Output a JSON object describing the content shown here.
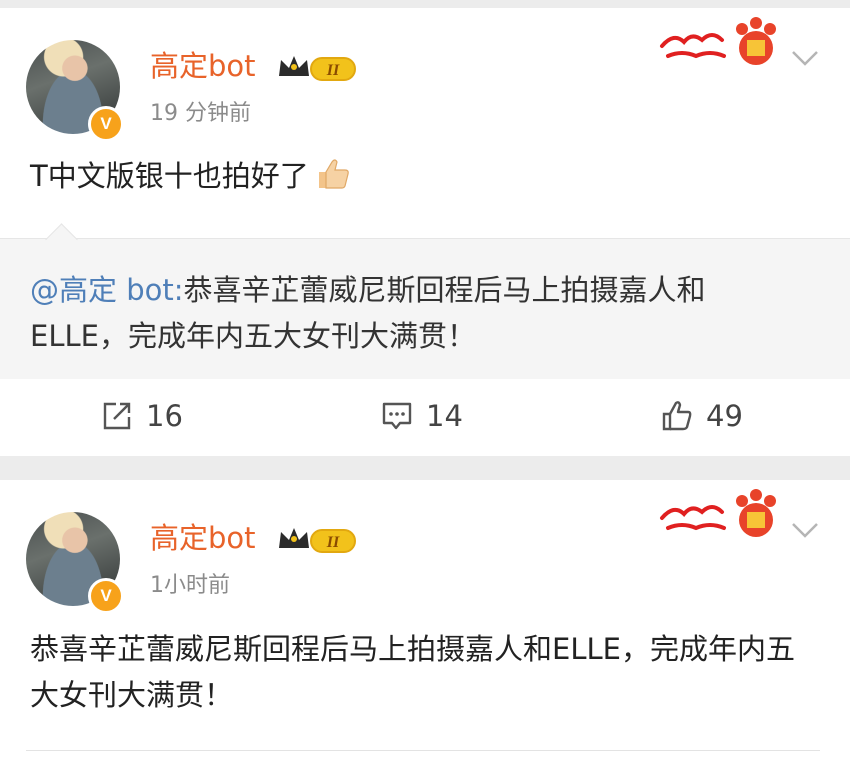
{
  "posts": [
    {
      "username": "高定bot",
      "level_badge": "II",
      "time": "19 分钟前",
      "content": "T中文版银十也拍好了",
      "content_emoji": "thumbs-up-icon",
      "quote": {
        "user": "@高定 bot:",
        "text": "恭喜辛芷蕾威尼斯回程后马上拍摄嘉人和ELLE，完成年内五大女刊大满贯！"
      },
      "actions": {
        "repost": "16",
        "comment": "14",
        "like": "49"
      }
    },
    {
      "username": "高定bot",
      "level_badge": "II",
      "time": "1小时前",
      "content": "恭喜辛芷蕾威尼斯回程后马上拍摄嘉人和ELLE，完成年内五大女刊大满贯！"
    }
  ],
  "colors": {
    "username": "#e8632a",
    "quote_user": "#4f7fb8",
    "verified": "#f7a21b"
  }
}
